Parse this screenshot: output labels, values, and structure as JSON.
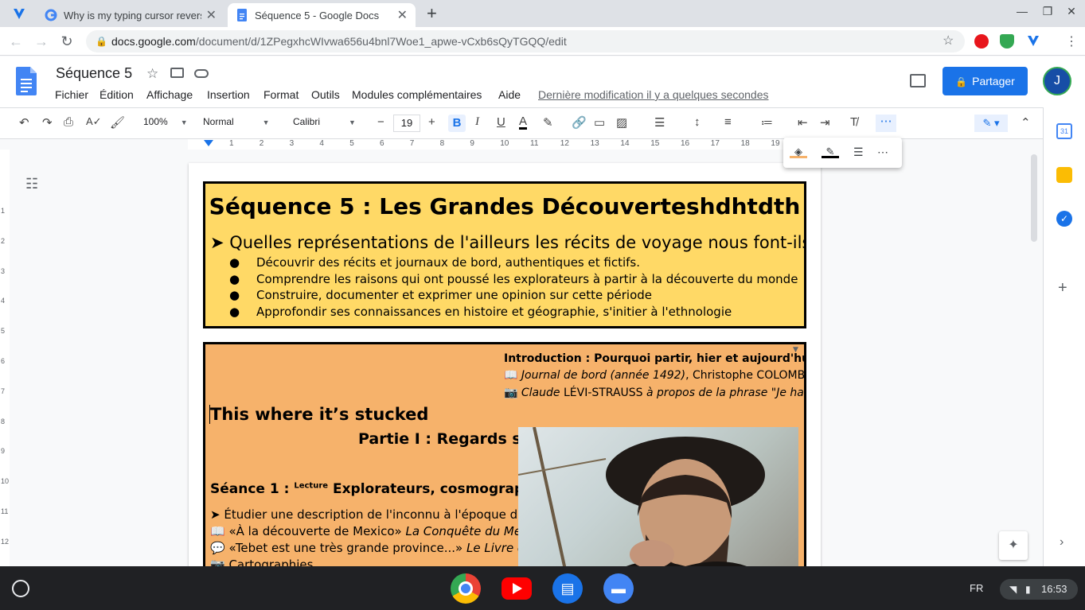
{
  "browser": {
    "tabs": [
      {
        "title": "Why is my typing cursor reverse",
        "active": false
      },
      {
        "title": "Séquence 5 - Google Docs",
        "active": true
      }
    ],
    "url_host": "docs.google.com",
    "url_path": "/document/d/1ZPegxhcWIvwa656u4bnl7Woe1_apwe-vCxb6sQyTGQQ/edit"
  },
  "docs": {
    "title": "Séquence 5",
    "menus": [
      "Fichier",
      "Édition",
      "Affichage",
      "Insertion",
      "Format",
      "Outils",
      "Modules complémentaires",
      "Aide"
    ],
    "last_modified": "Dernière modification il y a quelques secondes",
    "share_label": "Partager",
    "avatar_initial": "J"
  },
  "format_toolbar": {
    "zoom": "100%",
    "style": "Normal",
    "font": "Calibri",
    "font_size": "19",
    "bold_active": true
  },
  "ruler": {
    "ticks": [
      "1",
      "2",
      "3",
      "4",
      "5",
      "6",
      "7",
      "8",
      "9",
      "10",
      "11",
      "12",
      "13",
      "14",
      "15",
      "16",
      "17",
      "18",
      "19"
    ]
  },
  "vertical_ruler": {
    "ticks": [
      "1",
      "2",
      "3",
      "4",
      "5",
      "6",
      "7",
      "8",
      "9",
      "10",
      "11",
      "12"
    ]
  },
  "document": {
    "box1": {
      "title": "Séquence 5 : Les Grandes Découverteshdhtdth",
      "question": "➤ Quelles représentations de l'ailleurs les récits de voyage nous font-ils d",
      "bullets": [
        "Découvrir des récits et journaux de bord, authentiques et fictifs.",
        "Comprendre les raisons qui ont poussé les explorateurs à partir à la découverte du monde",
        "Construire, documenter et exprimer une opinion sur cette période",
        "Approfondir ses connaissances en histoire et géographie, s'initier à l'ethnologie"
      ]
    },
    "box2": {
      "intro": "Introduction : Pourquoi partir, hier et aujourd'hui ?",
      "intro_line1_icon": "📖",
      "intro_line1_italic": "Journal de bord (année 1492)",
      "intro_line1_rest": ", Christophe COLOMB",
      "intro_line2_icon": "📷",
      "intro_line2_italic": "Claude",
      "intro_line2_rest": " LÉVI-STRAUSS ",
      "intro_line2_tail": "à propos de la phrase \"Je ha",
      "cursor_line": "This where it’s stucked",
      "part": "Partie I : Regards su",
      "seance_prefix": "Séance 1 : ",
      "seance_sup": "Lecture",
      "seance_title": " Explorateurs, cosmographe",
      "line1": "➤ Étudier une description de l'inconnu à l'époque des",
      "line2_icon": "📖",
      "line2_text": "  «À la découverte de Mexico» ",
      "line2_italic": "La Conquête du Mexic",
      "line3_icon": "💬",
      "line3_text": " «Tebet est une très grande province...» ",
      "line3_italic": "Le Livre des",
      "line4_icon": "📷",
      "line4_text": " Cartographies"
    }
  },
  "shelf": {
    "lang": "FR",
    "time": "16:53"
  },
  "colors": {
    "box1_bg": "#ffd966",
    "box2_bg": "#f6b26b",
    "share_bg": "#1a73e8"
  }
}
